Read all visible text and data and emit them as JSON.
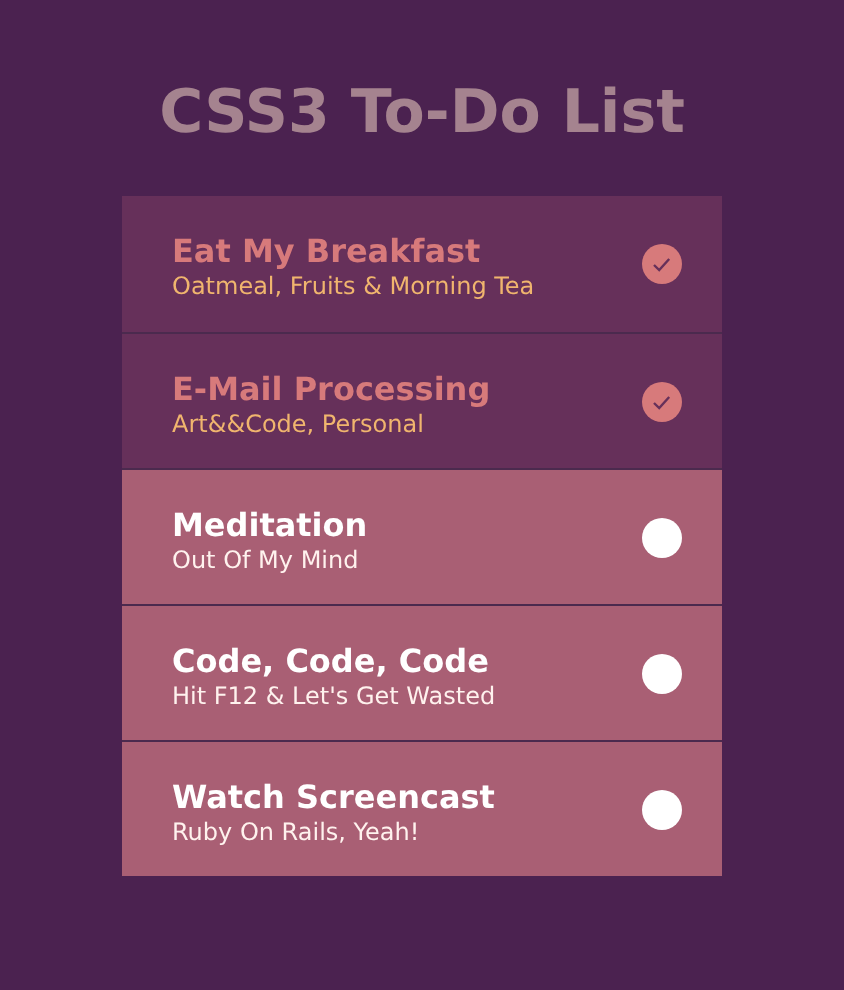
{
  "title": "CSS3 To-Do List",
  "tasks": [
    {
      "title": "Eat My Breakfast",
      "subtitle": "Oatmeal, Fruits & Morning Tea",
      "checked": true
    },
    {
      "title": "E-Mail Processing",
      "subtitle": "Art&&Code, Personal",
      "checked": true
    },
    {
      "title": "Meditation",
      "subtitle": "Out Of My Mind",
      "checked": false
    },
    {
      "title": "Code, Code, Code",
      "subtitle": "Hit F12 & Let's Get Wasted",
      "checked": false
    },
    {
      "title": "Watch Screencast",
      "subtitle": "Ruby On Rails, Yeah!",
      "checked": false
    }
  ]
}
